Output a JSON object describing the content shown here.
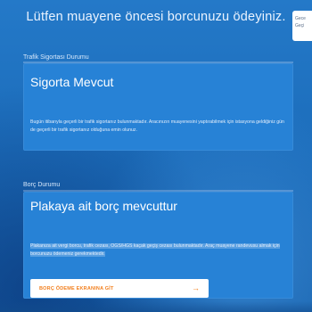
{
  "page": {
    "title": "Lütfen muayene öncesi borcunuzu ödeyiniz."
  },
  "side_panel": {
    "line1": "Gece",
    "line2": "Geçi"
  },
  "insurance": {
    "section_label": "Trafik Sigortası Durumu",
    "heading": "Sigorta Mevcut",
    "text": "Bugün itibarıyla geçerli bir trafik sigortanız bulunmaktadır. Aracınızın muayenesini yaptırabilmek için istasyona geldiğiniz gün de geçerli bir trafik sigortanız olduğuna emin olunuz."
  },
  "debt": {
    "section_label": "Borç Durumu",
    "heading": "Plakaya ait borç mevcuttur",
    "text": "Plakanıza ait vergi borcu, trafik cezası, OGS/HGS kaçak geçiş cezası bulunmaktadır. Araç muayene randevusu almak için borcunuzu ödemeniz gerekmektedir.",
    "button_label": "BORÇ ÖDEME EKRANINA GİT",
    "button_arrow": "→"
  },
  "colors": {
    "background": "#1d6fbd",
    "panel": "#2782d6",
    "button_text": "#f27f1d",
    "button_bg": "#ffffff"
  },
  "icons": {
    "button": "arrow-right-icon"
  }
}
